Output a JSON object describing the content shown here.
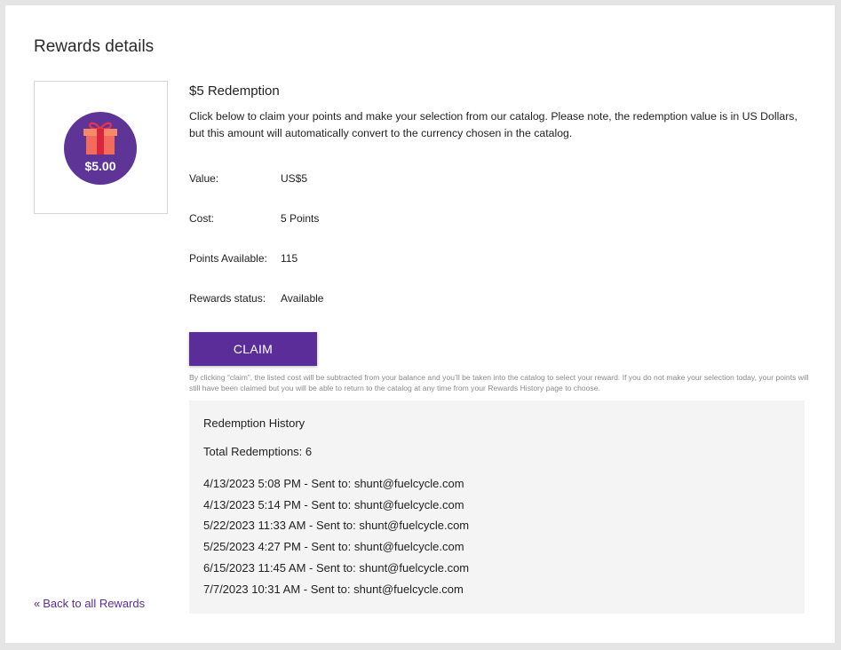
{
  "page": {
    "title": "Rewards details"
  },
  "reward": {
    "image_amount": "$5.00",
    "title": "$5 Redemption",
    "description": "Click below to claim your points and make your selection from our catalog. Please note, the redemption value is in US Dollars, but this amount will automatically convert to the currency chosen in the catalog.",
    "details": [
      {
        "label": "Value:",
        "value": "US$5"
      },
      {
        "label": "Cost:",
        "value": "5 Points"
      },
      {
        "label": "Points Available:",
        "value": "115"
      },
      {
        "label": "Rewards status:",
        "value": "Available"
      }
    ],
    "claim_label": "CLAIM",
    "claim_note": "By clicking “claim”, the listed cost will be subtracted from your balance and you’ll be taken into the catalog to select your reward. If you do not make your selection today, your points will still have been claimed but you will be able to return to the catalog at any time from your Rewards History page to choose."
  },
  "history": {
    "title": "Redemption History",
    "total": "Total Redemptions: 6",
    "items": [
      "4/13/2023 5:08 PM - Sent to: shunt@fuelcycle.com",
      "4/13/2023 5:14 PM - Sent to: shunt@fuelcycle.com",
      "5/22/2023 11:33 AM - Sent to: shunt@fuelcycle.com",
      "5/25/2023 4:27 PM - Sent to: shunt@fuelcycle.com",
      "6/15/2023 11:45 AM - Sent to: shunt@fuelcycle.com",
      "7/7/2023 10:31 AM - Sent to: shunt@fuelcycle.com"
    ]
  },
  "nav": {
    "back_label": "Back to all Rewards",
    "back_icon": "double-chevron-left-icon"
  },
  "colors": {
    "brand": "#5a2d98",
    "badge": "#5e3497",
    "gift": "#f26b5b"
  }
}
